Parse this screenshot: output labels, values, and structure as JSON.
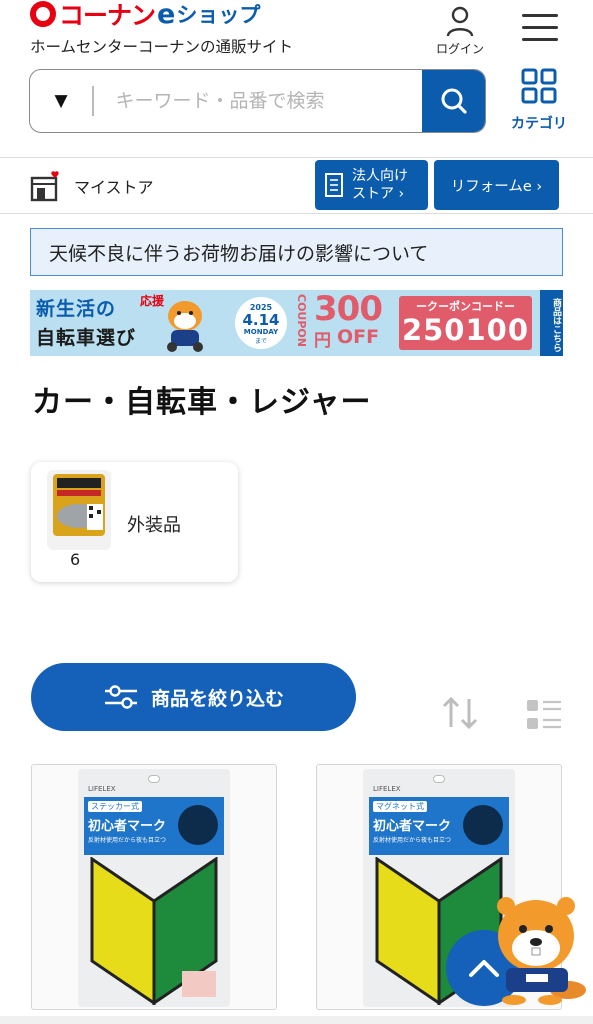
{
  "header": {
    "logo_text": "コーナン",
    "logo_e": "e",
    "logo_shop": "ショップ",
    "tagline": "ホームセンターコーナンの通販サイト",
    "login_label": "ログイン"
  },
  "search": {
    "dropdown_symbol": "▼",
    "placeholder": "キーワード・品番で検索",
    "category_label": "カテゴリ"
  },
  "store_bar": {
    "mystore_label": "マイストア",
    "corporate_label": "法人向け\nストア ›",
    "reform_label": "リフォームe ›"
  },
  "notice": {
    "text": "天候不良に伴うお荷物お届けの影響について"
  },
  "banner": {
    "title_line1": "新生活の",
    "title_line2": "自転車選び",
    "cheer": "応援",
    "year": "2025",
    "date": "4.14",
    "weekday": "MONDAY",
    "until": "まで",
    "coupon_word": "COUPON",
    "amount": "300",
    "yen": "円",
    "off": "OFF",
    "code_label": "ークーポンコードー",
    "code": "250100",
    "side_text": "商品はこちら"
  },
  "page": {
    "title": "カー・自転車・レジャー"
  },
  "subcategories": [
    {
      "label": "外装品",
      "count": "6"
    }
  ],
  "filter": {
    "label": "商品を絞り込む"
  },
  "products": [
    {
      "brand": "LIFELEX",
      "type": "ステッカー式",
      "name": "初心者マーク",
      "sub": "反射材使用だから夜も目立つ"
    },
    {
      "brand": "LIFELEX",
      "type": "マグネット式",
      "name": "初心者マーク",
      "sub": "反射材使用だから夜も目立つ"
    }
  ],
  "colors": {
    "brand_red": "#e60012",
    "brand_blue": "#0b5cad",
    "button_blue": "#1560b8"
  }
}
